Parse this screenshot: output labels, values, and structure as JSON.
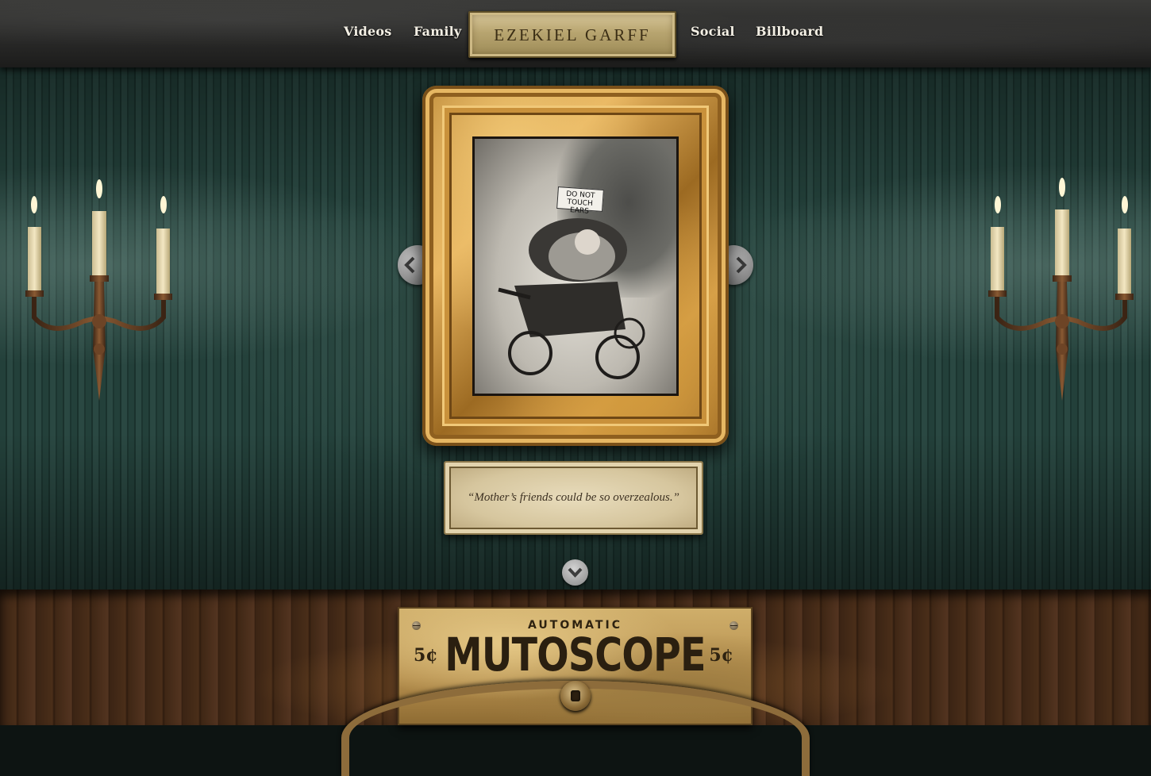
{
  "nav": {
    "left_items": [
      {
        "label": "Videos"
      },
      {
        "label": "Family"
      }
    ],
    "brand": "EZEKIEL GARFF",
    "right_items": [
      {
        "label": "Social"
      },
      {
        "label": "Billboard"
      }
    ]
  },
  "gallery": {
    "photo_sign_text": "DO NOT TOUCH EARS",
    "caption": "“Mother’s friends could be so overzealous.”",
    "prev_icon": "chevron-left-icon",
    "next_icon": "chevron-right-icon",
    "scroll_down_icon": "chevron-down-icon"
  },
  "mutoscope": {
    "top_label": "AUTOMATIC",
    "title": "MUTOSCOPE",
    "price_left": "5¢",
    "price_right": "5¢"
  },
  "colors": {
    "wallpaper": "#1f3a34",
    "gold_frame": "#d9a24c",
    "nav_text": "#f3efe4",
    "wood": "#3a2414"
  }
}
